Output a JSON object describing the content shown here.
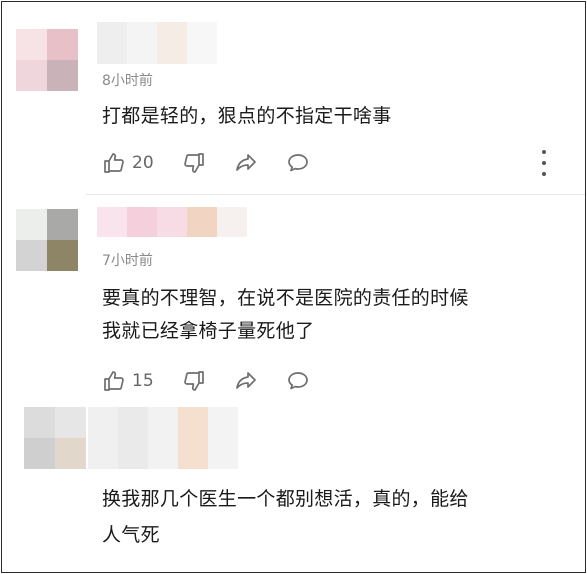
{
  "comments": [
    {
      "time": "8小时前",
      "text": "打都是轻的，狠点的不指定干啥事",
      "likes": "20",
      "avatar_colors": [
        "#f7e3e6",
        "#e8c1c8",
        "#efd6dc",
        "#c9b3b8"
      ],
      "name_colors": [
        "#eeeeee",
        "#f4f4f4",
        "#f6ece6",
        "#f7f7f7"
      ]
    },
    {
      "time": "7小时前",
      "text_line1": "要真的不理智，在说不是医院的责任的时候",
      "text_line2": "我就已经拿椅子量死他了",
      "likes": "15",
      "avatar_colors": [
        "#eceeec",
        "#a9aaa7",
        "#d2d3d2",
        "#8e8466"
      ],
      "name_colors": [
        "#f9e3ec",
        "#f5cfdc",
        "#f7dce5",
        "#f2d4c3",
        "#f6f1ef"
      ]
    },
    {
      "text_line1": "换我那几个医生一个都别想活，真的，能给",
      "text_line2": "人气死",
      "avatar_colors": [
        "#dcdcdc",
        "#e6e6e6",
        "#cfcfcf",
        "#e2d7cb"
      ],
      "name_colors": [
        "#f0f0f0",
        "#eaeaea",
        "#f2f2f2",
        "#f5dfcf",
        "#f3f3f3"
      ]
    }
  ],
  "icons": {
    "like": "thumbs-up-icon",
    "dislike": "thumbs-down-icon",
    "share": "share-icon",
    "reply": "comment-bubble-icon",
    "more": "more-vertical-icon"
  }
}
